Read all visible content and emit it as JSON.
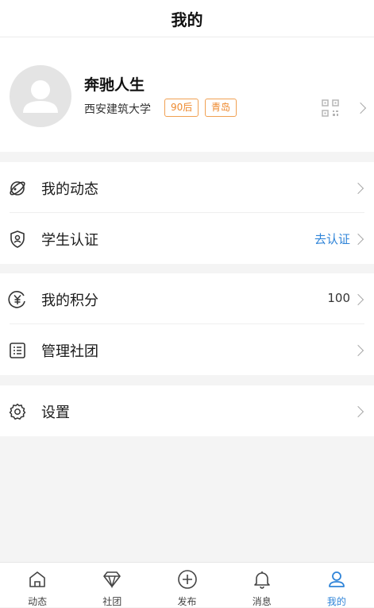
{
  "header": {
    "title": "我的"
  },
  "profile": {
    "nickname": "奔驰人生",
    "school": "西安建筑大学",
    "tags": [
      "90后",
      "青岛"
    ]
  },
  "menu_groups": [
    {
      "items": [
        {
          "label": "我的动态",
          "icon": "planet-icon",
          "value": ""
        },
        {
          "label": "学生认证",
          "icon": "shield-user-icon",
          "value": "去认证"
        }
      ]
    },
    {
      "items": [
        {
          "label": "我的积分",
          "icon": "yen-coin-icon",
          "value": "100"
        },
        {
          "label": "管理社团",
          "icon": "list-card-icon",
          "value": ""
        }
      ]
    },
    {
      "items": [
        {
          "label": "设置",
          "icon": "gear-icon",
          "value": ""
        }
      ]
    }
  ],
  "tabbar": {
    "active": 4,
    "active_color": "#2f84d8",
    "items": [
      {
        "label": "动态",
        "icon": "home-icon"
      },
      {
        "label": "社团",
        "icon": "diamond-icon"
      },
      {
        "label": "发布",
        "icon": "plus-circle-icon"
      },
      {
        "label": "消息",
        "icon": "bell-icon"
      },
      {
        "label": "我的",
        "icon": "user-icon"
      }
    ]
  }
}
